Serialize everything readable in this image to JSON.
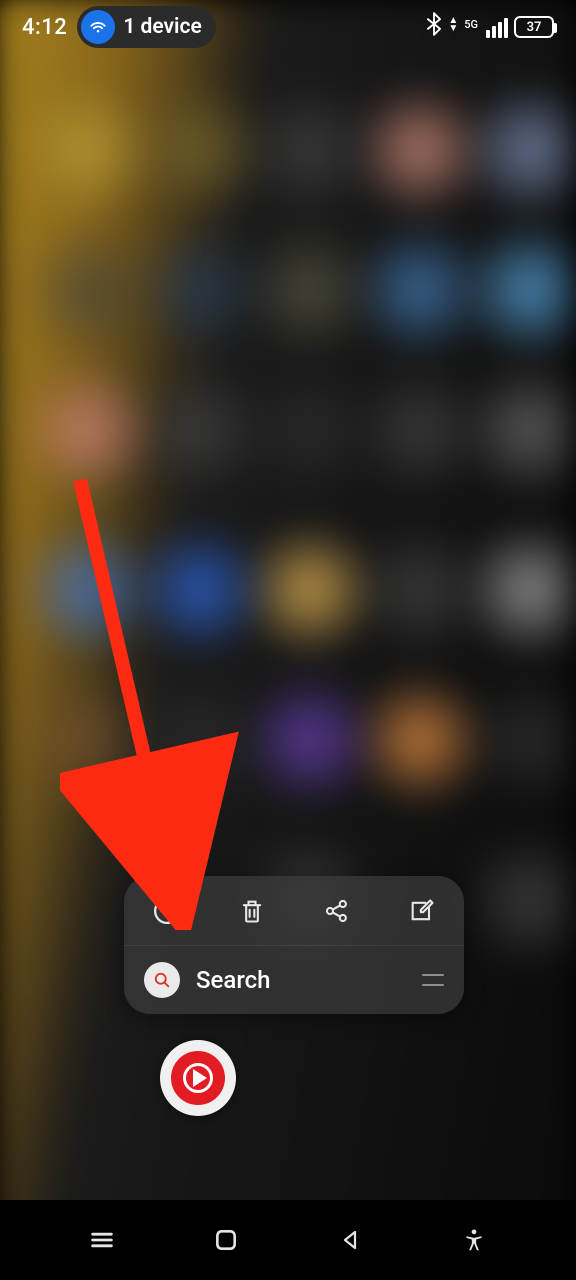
{
  "statusbar": {
    "time": "4:12",
    "device_count_label": "1 device",
    "network_label": "5G",
    "battery_pct": "37"
  },
  "popup": {
    "search_label": "Search"
  }
}
